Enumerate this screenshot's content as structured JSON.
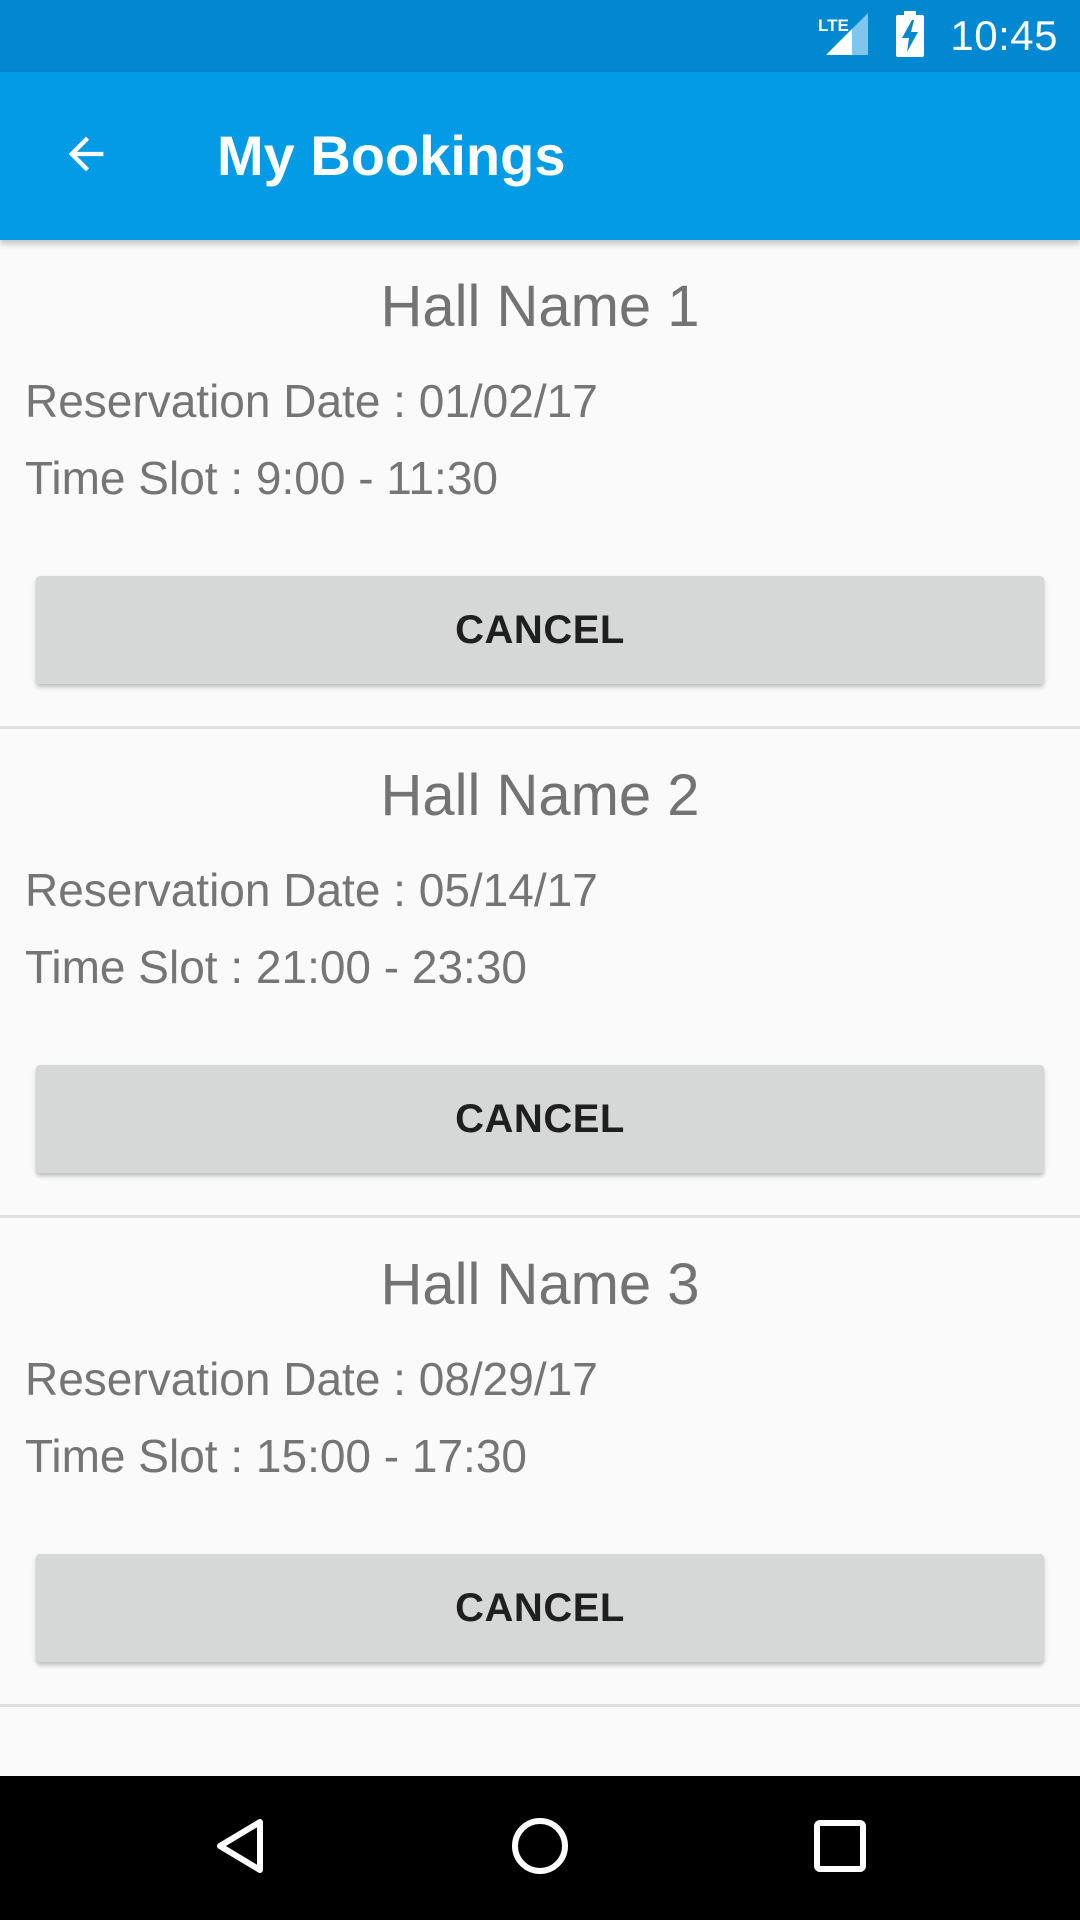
{
  "status_bar": {
    "network_label": "LTE",
    "time": "10:45",
    "icons": [
      "lte-signal-icon",
      "battery-charging-icon"
    ]
  },
  "app_bar": {
    "title": "My Bookings",
    "back_icon": "arrow-back-icon"
  },
  "bookings": [
    {
      "hall_name": "Hall Name 1",
      "reservation_date": "Reservation Date : 01/02/17",
      "time_slot": "Time Slot : 9:00 - 11:30",
      "cancel_label": "CANCEL"
    },
    {
      "hall_name": "Hall Name 2",
      "reservation_date": "Reservation Date : 05/14/17",
      "time_slot": "Time Slot : 21:00 - 23:30",
      "cancel_label": "CANCEL"
    },
    {
      "hall_name": "Hall Name 3",
      "reservation_date": "Reservation Date : 08/29/17",
      "time_slot": "Time Slot : 15:00 - 17:30",
      "cancel_label": "CANCEL"
    }
  ],
  "nav_bar": {
    "icons": [
      "nav-back-icon",
      "nav-home-icon",
      "nav-recents-icon"
    ]
  },
  "colors": {
    "status_bar": "#0288d1",
    "app_bar": "#039be5",
    "background": "#fafafa",
    "button": "#d6d7d7",
    "nav_bar": "#000000"
  }
}
